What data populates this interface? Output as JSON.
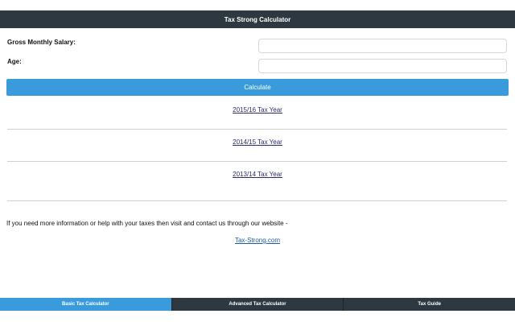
{
  "app": {
    "title": "Tax Strong Calculator"
  },
  "form": {
    "salary_label": "Gross Monthly Salary:",
    "salary_value": "",
    "age_label": "Age:",
    "age_value": "",
    "calculate_label": "Calculate"
  },
  "tax_years": [
    {
      "label": "2015/16 Tax Year"
    },
    {
      "label": "2014/15 Tax Year"
    },
    {
      "label": "2013/14 Tax Year"
    }
  ],
  "info": {
    "text": "If you need more information or help with your taxes then visit and contact us through our website -",
    "website_label": "Tax-Strong.com"
  },
  "tabs": [
    {
      "label": "Basic Tax Calculator",
      "active": true
    },
    {
      "label": "Advanced Tax Calculator",
      "active": false
    },
    {
      "label": "Tax Guide",
      "active": false
    }
  ],
  "colors": {
    "header_bg": "#2d3841",
    "accent": "#3a9bdc",
    "link": "#2a2a6e"
  }
}
